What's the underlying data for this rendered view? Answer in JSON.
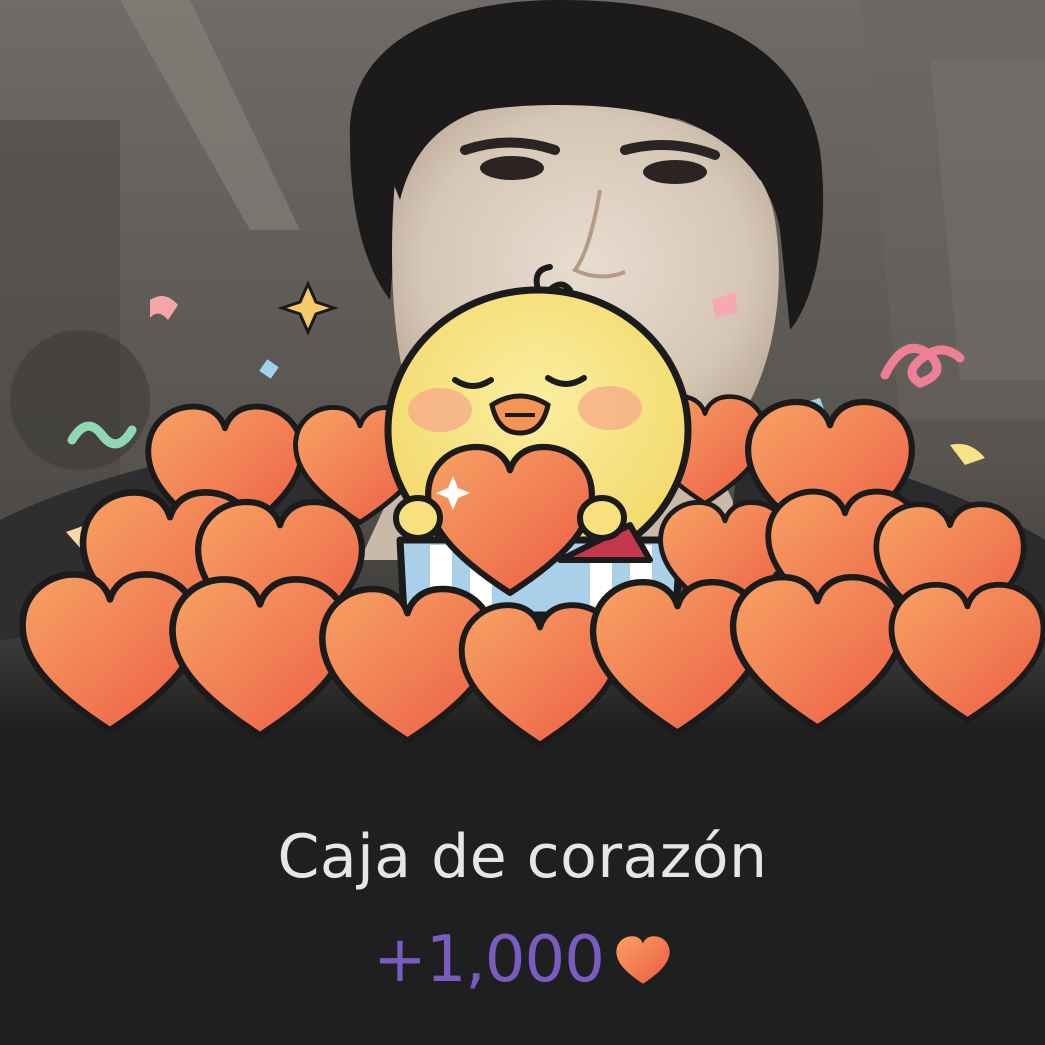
{
  "reward": {
    "title": "Caja de corazón",
    "amount": "+1,000",
    "currency_icon": "heart-icon"
  },
  "colors": {
    "background": "#1f1f1f",
    "title_text": "#e6e6e6",
    "amount_text": "#7a5bc0",
    "heart_light": "#f9a061",
    "heart_dark": "#ee5a45",
    "chick": "#f8e586",
    "box_blue": "#a9cfe9"
  }
}
